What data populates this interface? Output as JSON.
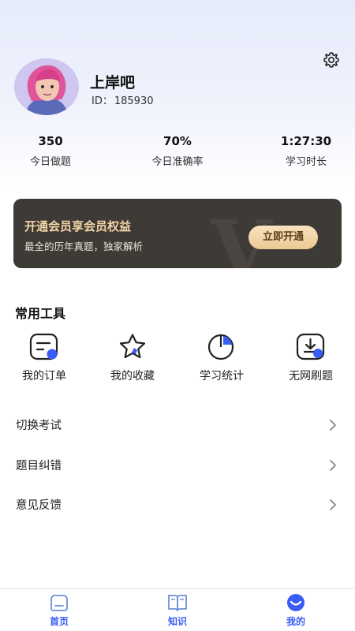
{
  "colors": {
    "accent": "#3a5cf5",
    "vip_bg": "#3e3a36",
    "vip_gold": "#f3d6a8",
    "tab_inactive": "#6f8fd8"
  },
  "profile": {
    "name": "上岸吧",
    "id_label": "ID：",
    "id_value": "185930",
    "avatar_icon": "avatar-illustration"
  },
  "stats": [
    {
      "value": "350",
      "label": "今日做题"
    },
    {
      "value": "70%",
      "label": "今日准确率"
    },
    {
      "value": "1:27:30",
      "label": "学习时长"
    }
  ],
  "vip": {
    "title": "开通会员享会员权益",
    "subtitle": "最全的历年真题，独家解析",
    "button": "立即开通",
    "watermark": "V"
  },
  "tools": {
    "title": "常用工具",
    "items": [
      {
        "label": "我的订单",
        "icon": "order-icon"
      },
      {
        "label": "我的收藏",
        "icon": "star-icon"
      },
      {
        "label": "学习统计",
        "icon": "pie-chart-icon"
      },
      {
        "label": "无网刷题",
        "icon": "download-icon"
      }
    ]
  },
  "menu": [
    {
      "label": "切换考试"
    },
    {
      "label": "题目纠错"
    },
    {
      "label": "意见反馈"
    }
  ],
  "tabbar": [
    {
      "label": "首页",
      "icon": "home-icon",
      "active": false
    },
    {
      "label": "知识",
      "icon": "book-icon",
      "active": false
    },
    {
      "label": "我的",
      "icon": "profile-icon",
      "active": true
    }
  ]
}
